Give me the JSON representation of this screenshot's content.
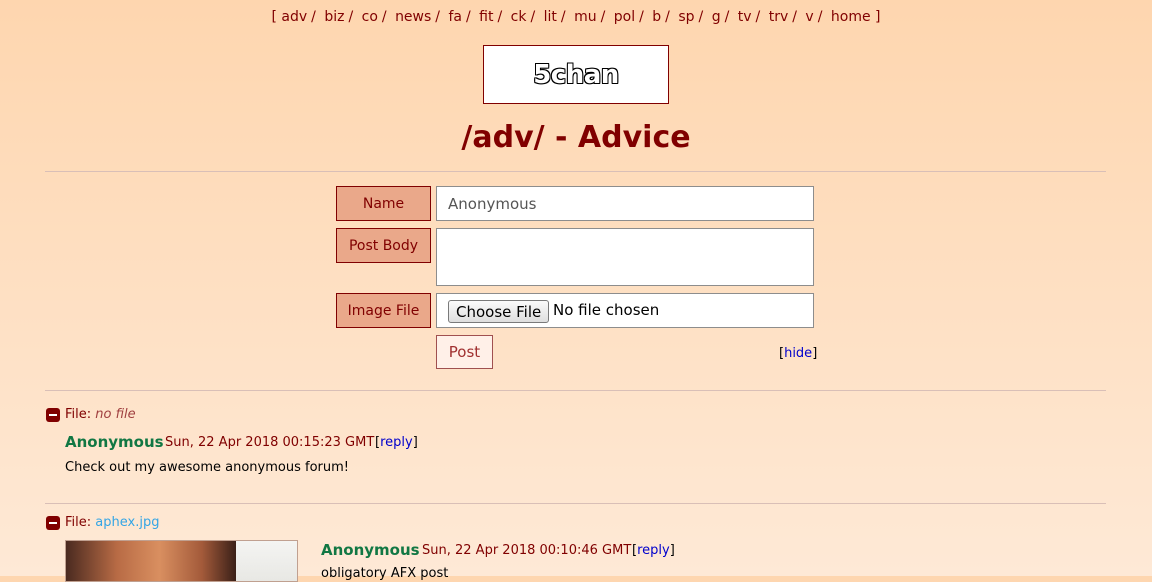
{
  "nav": {
    "open": "[",
    "close": "]",
    "separator": "/",
    "boards": [
      "adv",
      "biz",
      "co",
      "news",
      "fa",
      "fit",
      "ck",
      "lit",
      "mu",
      "pol",
      "b",
      "sp",
      "g",
      "tv",
      "trv",
      "v",
      "home"
    ]
  },
  "logo": {
    "text": "5chan"
  },
  "board": {
    "title": "/adv/ - Advice"
  },
  "form": {
    "name_label": "Name",
    "name_placeholder": "Anonymous",
    "body_label": "Post Body",
    "image_label": "Image File",
    "choose_file": "Choose File",
    "file_status": "No file chosen",
    "post_button": "Post",
    "hide_open": "[",
    "hide_link": "hide",
    "hide_close": "]"
  },
  "posts": [
    {
      "file_label": "File:",
      "file_value": "no file",
      "name": "Anonymous",
      "date": "Sun, 22 Apr 2018 00:15:23 GMT",
      "reply_open": "[",
      "reply_link": "reply",
      "reply_close": "]",
      "body": "Check out my awesome anonymous forum!"
    },
    {
      "file_label": "File:",
      "file_value": "aphex.jpg",
      "name": "Anonymous",
      "date": "Sun, 22 Apr 2018 00:10:46 GMT",
      "reply_open": "[",
      "reply_link": "reply",
      "reply_close": "]",
      "body": "obligatory AFX post"
    }
  ],
  "colors": {
    "background_top": "#fed6af",
    "background_bottom": "#fee9d6",
    "title": "#800000",
    "label_bg": "#eaa88a",
    "poster_name": "#117743",
    "link": "#0000cc",
    "file_link": "#34a5e5"
  }
}
